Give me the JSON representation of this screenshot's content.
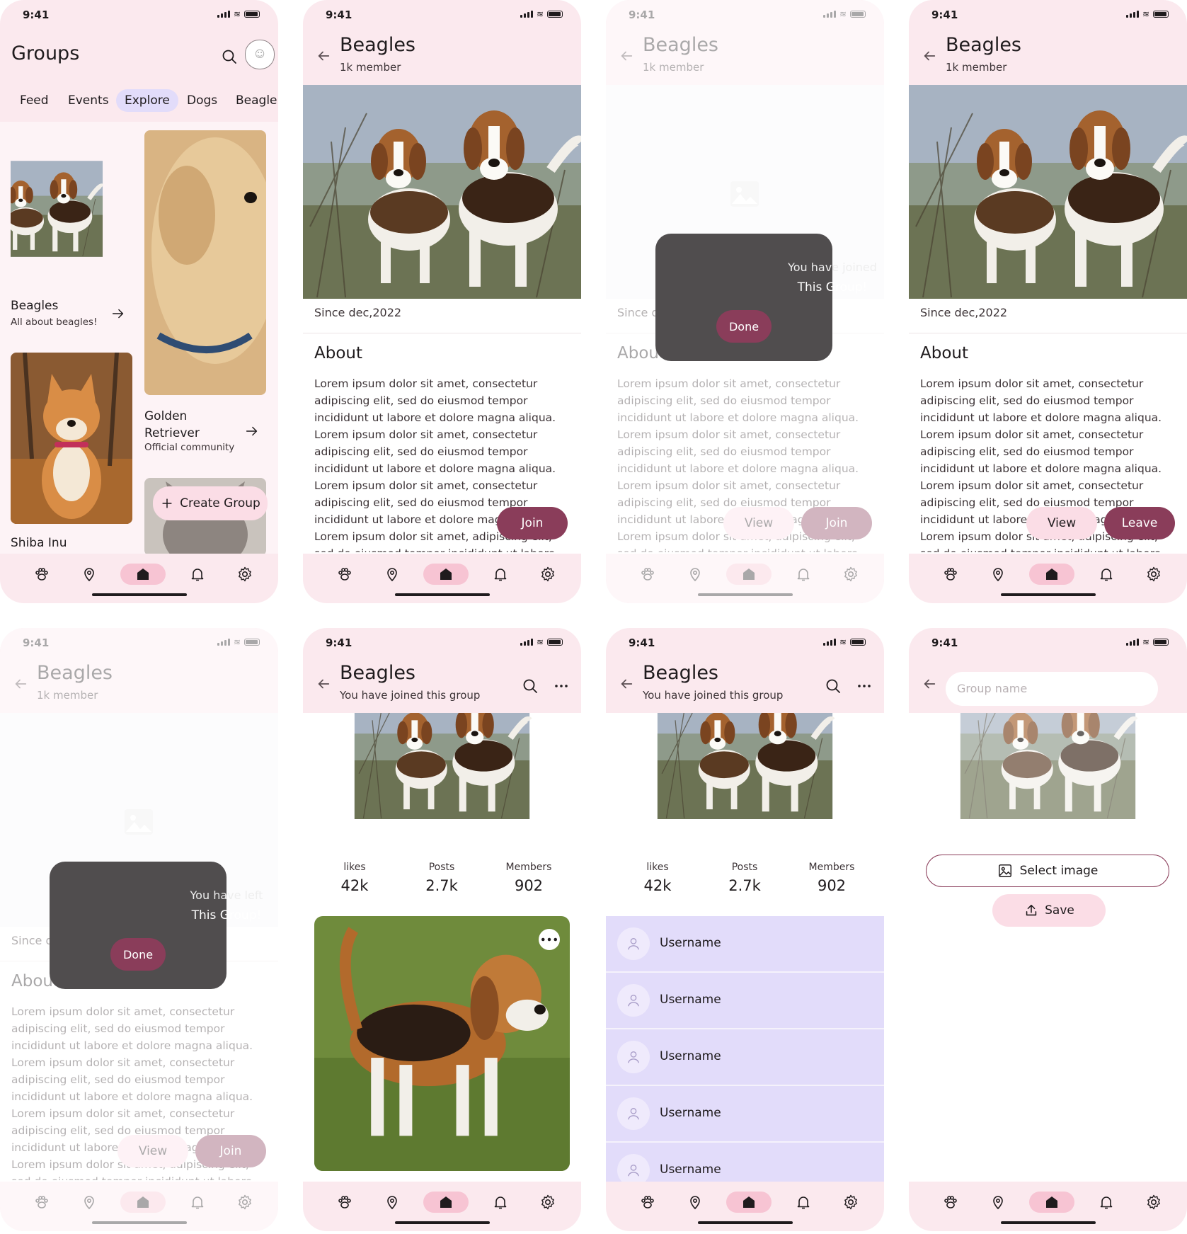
{
  "status": {
    "time": "9:41"
  },
  "groups_screen": {
    "title": "Groups",
    "tabs": [
      "Feed",
      "Events",
      "Explore",
      "Dogs",
      "Beagle"
    ],
    "active_tab": "Explore",
    "cards": [
      {
        "title": "Beagles",
        "subtitle": "All about beagles!"
      },
      {
        "title": "Golden Retriever",
        "subtitle": "Official community"
      },
      {
        "title": "Shiba Inu",
        "subtitle": ""
      }
    ],
    "create_label": "Create Group"
  },
  "group": {
    "name": "Beagles",
    "members_label": "1k member",
    "joined_label": "You have joined this group",
    "since": "Since dec,2022",
    "about_heading": "About",
    "about_text": "Lorem ipsum dolor sit amet, consectetur adipiscing elit, sed do eiusmod tempor incididunt ut labore et dolore magna aliqua. Lorem ipsum dolor sit amet, consectetur adipiscing elit, sed do eiusmod tempor incididunt ut labore et dolore magna aliqua. Lorem ipsum dolor sit amet, consectetur adipiscing elit, sed do eiusmod tempor incididunt ut labore et dolore magna aliqua. Lorem ipsum dolor sit amet, adipiscing elit, sed do eiusmod tempor incididunt ut labore et dolore magna aliqua. Lorem ipsum"
  },
  "buttons": {
    "join": "Join",
    "view": "View",
    "leave": "Leave",
    "done": "Done",
    "select_image": "Select image",
    "save": "Save"
  },
  "dialogs": {
    "joined": {
      "line1": "You have joined",
      "line2": "This Group!"
    },
    "left": {
      "line1": "You have left",
      "line2": "This Group!"
    }
  },
  "stats": [
    {
      "label": "likes",
      "value": "42k"
    },
    {
      "label": "Posts",
      "value": "2.7k"
    },
    {
      "label": "Members",
      "value": "902"
    }
  ],
  "members": [
    "Username",
    "Username",
    "Username",
    "Username",
    "Username"
  ],
  "edit": {
    "placeholder": "Group name"
  },
  "nav": [
    "paw-icon",
    "location-pin-icon",
    "home-icon",
    "bell-icon",
    "settings-icon"
  ],
  "colors": {
    "surface": "#fbe9ee",
    "primary": "#8a3d5a",
    "secondary_container": "#fbdde6",
    "tab_active": "#e2dcfa",
    "scrim_dialog": "#504d4e"
  }
}
